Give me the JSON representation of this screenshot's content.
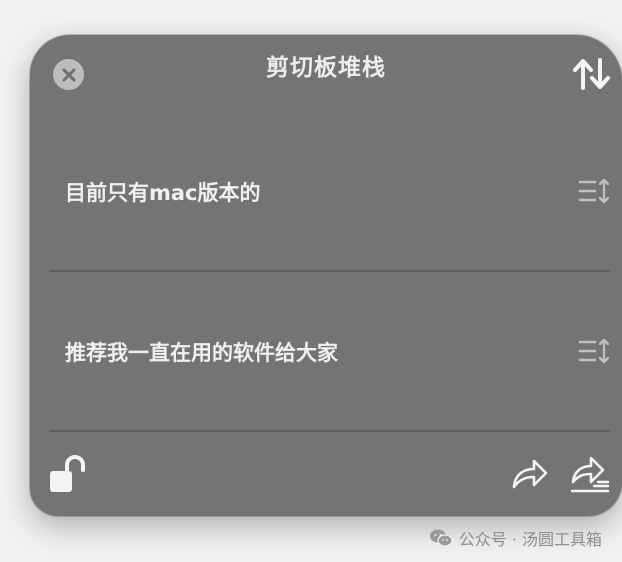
{
  "window": {
    "title": "剪切板堆栈"
  },
  "items": [
    {
      "text": "目前只有mac版本的"
    },
    {
      "text": "推荐我一直在用的软件给大家"
    }
  ],
  "icons": {
    "close": "close-icon",
    "sort": "sort-arrows-icon",
    "handle": "list-reorder-icon",
    "lock": "unlock-icon",
    "share": "share-forward-icon",
    "share_edit": "share-edit-icon"
  },
  "colors": {
    "panel_bg": "#737473",
    "text": "#f0f0f0",
    "divider": "#5e5f5e",
    "page_bg": "#f1f1f3"
  },
  "watermark": {
    "text": "公众号 · 汤圆工具箱"
  }
}
